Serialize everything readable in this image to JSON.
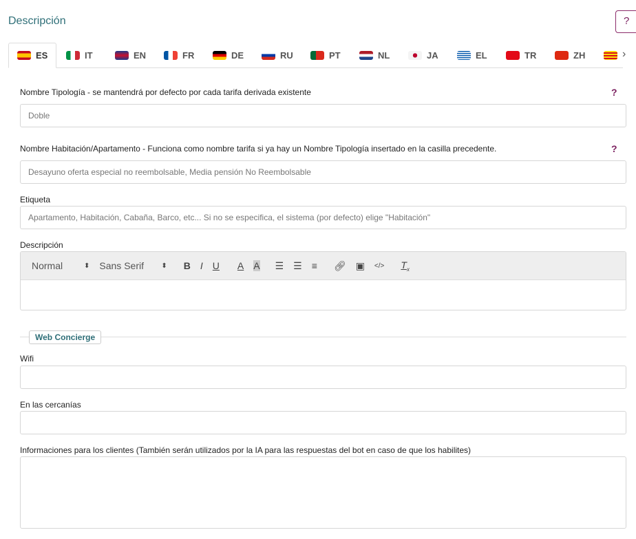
{
  "header": {
    "title": "Descripción",
    "help": "?"
  },
  "tabs": [
    {
      "code": "ES",
      "flag": "linear-gradient(#c60b1e 25%,#ffc400 25%,#ffc400 75%,#c60b1e 75%)"
    },
    {
      "code": "IT",
      "flag": "linear-gradient(90deg,#009246 33%,#fff 33%,#fff 66%,#ce2b37 66%)"
    },
    {
      "code": "EN",
      "flag": "linear-gradient(#1d3a8a,#c8102e,#1d3a8a)"
    },
    {
      "code": "FR",
      "flag": "linear-gradient(90deg,#0055a4 33%,#fff 33%,#fff 66%,#ef4135 66%)"
    },
    {
      "code": "DE",
      "flag": "linear-gradient(#000 33%,#dd0000 33%,#dd0000 66%,#ffce00 66%)"
    },
    {
      "code": "RU",
      "flag": "linear-gradient(#fff 33%,#0039a6 33%,#0039a6 66%,#d52b1e 66%)"
    },
    {
      "code": "PT",
      "flag": "linear-gradient(90deg,#046a38 40%,#da291c 40%)"
    },
    {
      "code": "NL",
      "flag": "linear-gradient(#ae1c28 33%,#fff 33%,#fff 66%,#21468b 66%)"
    },
    {
      "code": "JA",
      "flag": "radial-gradient(circle,#bc002d 25%,#f4f4f4 28%)"
    },
    {
      "code": "EL",
      "flag": "repeating-linear-gradient(#0d5eaf 0 1.5px,#fff 1.5px 3px)"
    },
    {
      "code": "TR",
      "flag": "#e30a17"
    },
    {
      "code": "ZH",
      "flag": "#de2910"
    },
    {
      "code": "",
      "flag": "repeating-linear-gradient(#fcdd09 0 2px,#da121a 2px 4px)"
    }
  ],
  "fields": {
    "tipologia": {
      "label": "Nombre Tipología - se mantendrá por defecto por cada tarifa derivada existente",
      "placeholder": "Doble",
      "help": "?"
    },
    "habitacion": {
      "label": "Nombre Habitación/Apartamento - Funciona como nombre tarifa si ya hay un Nombre Tipología insertado en la casilla precedente.",
      "placeholder": "Desayuno oferta especial no reembolsable, Media pensión No Reembolsable",
      "help": "?"
    },
    "etiqueta": {
      "label": "Etiqueta",
      "placeholder": "Apartamento, Habitación, Cabaña, Barco, etc... Si no se especifica, el sistema (por defecto) elige \"Habitación\""
    },
    "descripcion": {
      "label": "Descripción",
      "format": "Normal",
      "font": "Sans Serif"
    },
    "section": "Web Concierge",
    "wifi": {
      "label": "Wifi"
    },
    "cercanias": {
      "label": "En las cercanías"
    },
    "info": {
      "label": "Informaciones para los clientes (También serán utilizados por la IA para las respuestas del bot en caso de que los habilites)"
    }
  }
}
